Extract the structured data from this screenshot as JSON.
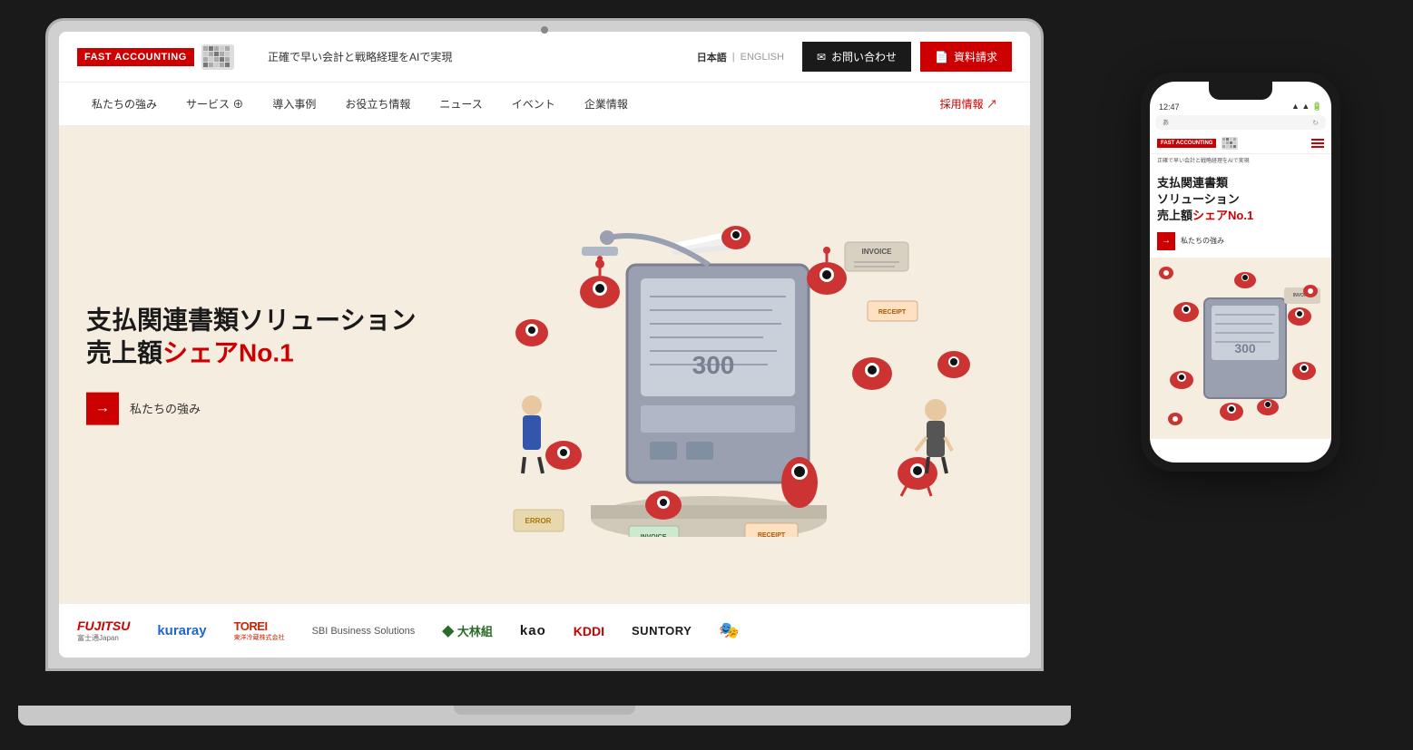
{
  "scene": {
    "bg_color": "#1a1a1a"
  },
  "laptop": {
    "header": {
      "logo_text": "FAST ACCOUNTING",
      "tagline": "正確で早い会計と戦略経理をAIで実現",
      "lang_ja": "日本語",
      "lang_separator": "|",
      "lang_en": "ENGLISH",
      "contact_label": "お問い合わせ",
      "docs_label": "資料請求"
    },
    "nav": {
      "items": [
        {
          "label": "私たちの強み"
        },
        {
          "label": "サービス ⊕"
        },
        {
          "label": "導入事例"
        },
        {
          "label": "お役立ち情報"
        },
        {
          "label": "ニュース"
        },
        {
          "label": "イベント"
        },
        {
          "label": "企業情報"
        },
        {
          "label": "採用情報 ↗"
        }
      ]
    },
    "hero": {
      "title_line1": "支払関連書類ソリューション",
      "title_line2_plain": "売上額",
      "title_line2_red": "シェアNo.1",
      "cta_label": "私たちの強み",
      "machine_number": "300"
    },
    "logos": [
      {
        "text": "FUJITSU",
        "sub": "富士通Japan",
        "class": "logo-fujitsu"
      },
      {
        "text": "kuraray",
        "class": "logo-kuraray"
      },
      {
        "text": "TOREI 東洋冷蔵株式会社",
        "class": "logo-torei"
      },
      {
        "text": "SBI Business Solutions",
        "class": "logo-sbi"
      },
      {
        "text": "◆ 大林組",
        "class": "logo-obayashi"
      },
      {
        "text": "kao",
        "class": "logo-kao"
      },
      {
        "text": "KDDI",
        "class": "logo-kddi"
      },
      {
        "text": "SUNTORY",
        "class": "logo-suntory"
      },
      {
        "text": "🎭",
        "class": "logo-company"
      }
    ]
  },
  "phone": {
    "status_time": "12:47",
    "status_right": "📶 🔋",
    "logo_text": "FAST ACCOUNTING",
    "tagline": "正確で早い会計と戦略経理をAIで実現",
    "hero_line1": "支払関連書類",
    "hero_line2": "ソリューション",
    "hero_line3_plain": "売上額",
    "hero_line3_red": "シェアNo.1",
    "cta_label": "私たちの強み"
  },
  "colors": {
    "accent_red": "#cc0000",
    "dark": "#1a1a1a",
    "bg_hero": "#f5ede0",
    "text_dark": "#333333",
    "nav_bar": "#ffffff"
  }
}
